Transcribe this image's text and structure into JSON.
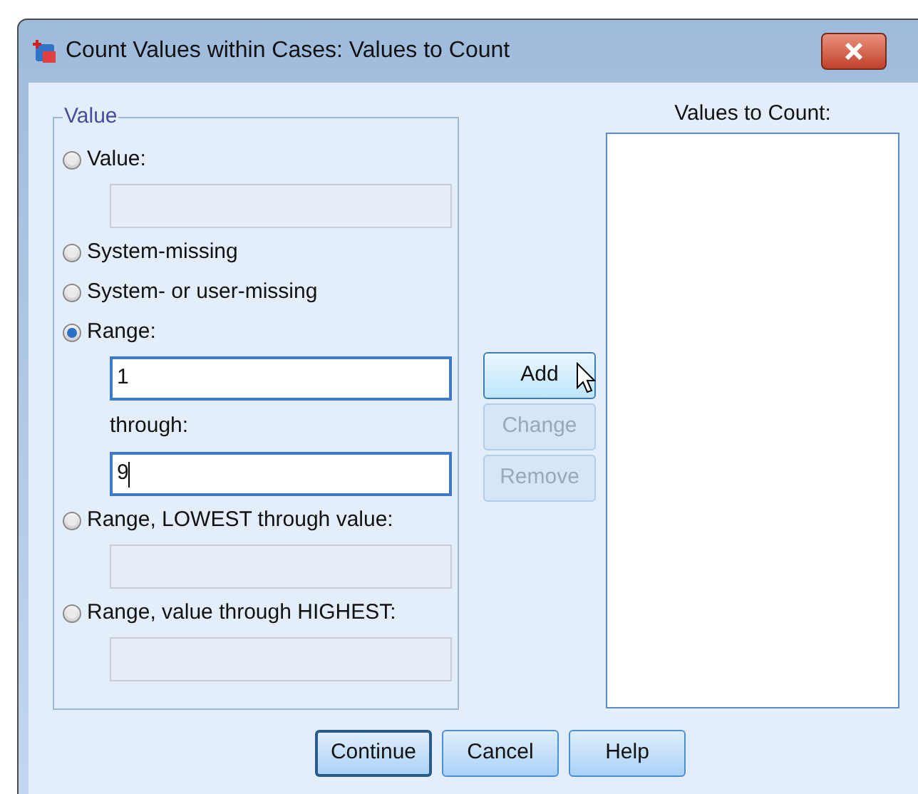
{
  "window": {
    "title": "Count Values within Cases: Values to Count"
  },
  "value_group": {
    "title": "Value",
    "options": [
      {
        "label": "Value:",
        "selected": false,
        "items": [
          {
            "kind": "input",
            "value": "",
            "enabled": false
          }
        ]
      },
      {
        "label": "System-missing",
        "selected": false
      },
      {
        "label": "System- or user-missing",
        "selected": false
      },
      {
        "label": "Range:",
        "selected": true,
        "items": [
          {
            "kind": "input",
            "value": "1",
            "enabled": true
          },
          {
            "kind": "label",
            "text": "through:"
          },
          {
            "kind": "input",
            "value": "9",
            "enabled": true,
            "caret": true
          }
        ]
      },
      {
        "label": "Range, LOWEST through value:",
        "selected": false,
        "items": [
          {
            "kind": "input",
            "value": "",
            "enabled": false
          }
        ]
      },
      {
        "label": "Range, value through HIGHEST:",
        "selected": false,
        "items": [
          {
            "kind": "input",
            "value": "",
            "enabled": false
          }
        ]
      }
    ]
  },
  "list_buttons": [
    {
      "label": "Add",
      "enabled": true
    },
    {
      "label": "Change",
      "enabled": false
    },
    {
      "label": "Remove",
      "enabled": false
    }
  ],
  "values_list": {
    "label": "Values to Count:"
  },
  "buttons": [
    {
      "label": "Continue",
      "default": true
    },
    {
      "label": "Cancel",
      "default": false
    },
    {
      "label": "Help",
      "default": false
    }
  ]
}
